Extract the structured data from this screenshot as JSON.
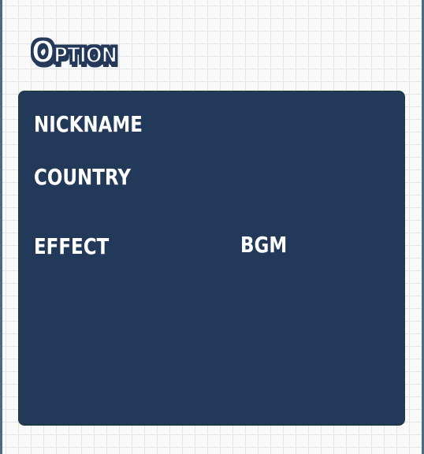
{
  "title": "Option",
  "panel": {
    "nickname_label": "NICKNAME",
    "country_label": "COUNTRY",
    "effect_label": "EFFECT",
    "bgm_label": "BGM"
  },
  "colors": {
    "panel_background": "#23395a",
    "title_outline": "#24395a",
    "page_background": "#f9f9fa",
    "grid_lines": "#e3e5e8",
    "text": "#ffffff"
  }
}
